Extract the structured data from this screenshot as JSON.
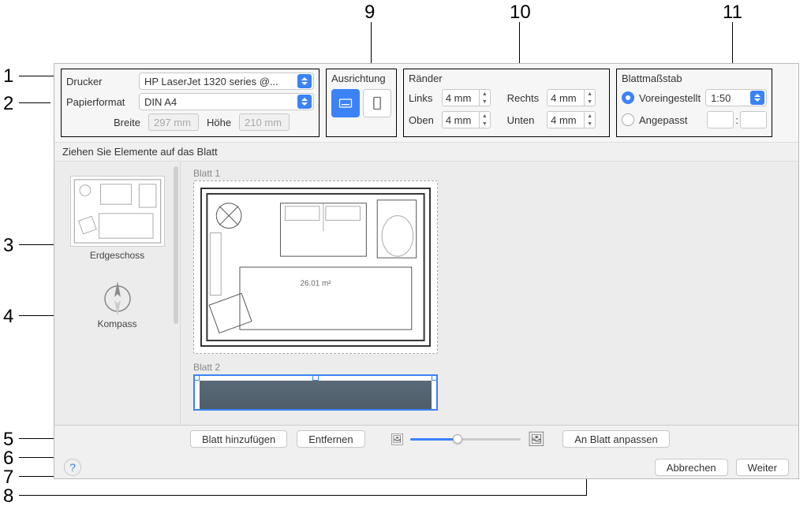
{
  "callouts": [
    "1",
    "2",
    "3",
    "4",
    "5",
    "6",
    "7",
    "8",
    "9",
    "10",
    "11"
  ],
  "printer": {
    "label": "Drucker",
    "value": "HP LaserJet 1320 series @..."
  },
  "paper": {
    "label": "Papierformat",
    "value": "DIN A4",
    "width_label": "Breite",
    "width_value": "297 mm",
    "height_label": "Höhe",
    "height_value": "210 mm"
  },
  "orientation": {
    "title": "Ausrichtung"
  },
  "margins": {
    "title": "Ränder",
    "left_label": "Links",
    "left_value": "4 mm",
    "right_label": "Rechts",
    "right_value": "4 mm",
    "top_label": "Oben",
    "top_value": "4 mm",
    "bottom_label": "Unten",
    "bottom_value": "4 mm"
  },
  "scale": {
    "title": "Blattmaßstab",
    "preset_label": "Voreingestellt",
    "preset_value": "1:50",
    "custom_label": "Angepasst",
    "ratio_sep": ":"
  },
  "hint": "Ziehen Sie Elemente auf das Blatt",
  "sidebar": {
    "floor_label": "Erdgeschoss",
    "compass_label": "Kompass"
  },
  "canvas": {
    "sheet1_label": "Blatt 1",
    "room_area": "26.01 m²",
    "sheet2_label": "Blatt 2"
  },
  "bottom": {
    "add_sheet": "Blatt hinzufügen",
    "remove": "Entfernen",
    "fit": "An Blatt anpassen"
  },
  "footer": {
    "help": "?",
    "cancel": "Abbrechen",
    "next": "Weiter"
  }
}
